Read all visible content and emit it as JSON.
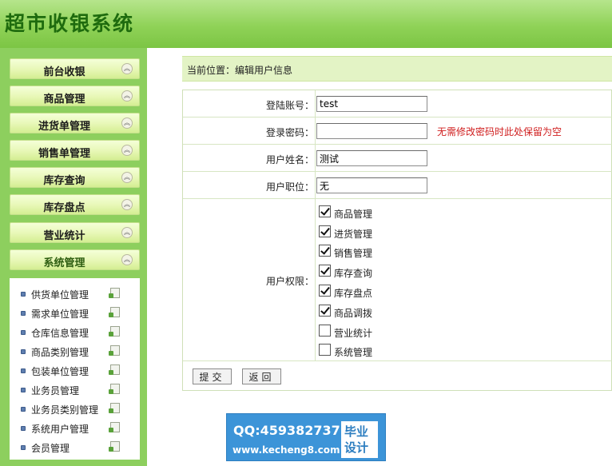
{
  "app": {
    "title": "超市收银系统"
  },
  "sidebar": {
    "nav": [
      {
        "label": "前台收银"
      },
      {
        "label": "商品管理"
      },
      {
        "label": "进货单管理"
      },
      {
        "label": "销售单管理"
      },
      {
        "label": "库存查询"
      },
      {
        "label": "库存盘点"
      },
      {
        "label": "营业统计"
      },
      {
        "label": "系统管理"
      }
    ],
    "chevron_glyph": "︽",
    "submenu": [
      {
        "label": "供货单位管理"
      },
      {
        "label": "需求单位管理"
      },
      {
        "label": "仓库信息管理"
      },
      {
        "label": "商品类别管理"
      },
      {
        "label": "包装单位管理"
      },
      {
        "label": "业务员管理"
      },
      {
        "label": "业务员类别管理"
      },
      {
        "label": "系统用户管理"
      },
      {
        "label": "会员管理"
      }
    ]
  },
  "breadcrumb": "当前位置：编辑用户信息",
  "form": {
    "account": {
      "label": "登陆账号：",
      "value": "test"
    },
    "password": {
      "label": "登录密码：",
      "value": "",
      "hint": "无需修改密码时此处保留为空"
    },
    "name": {
      "label": "用户姓名：",
      "value": "测试"
    },
    "position": {
      "label": "用户职位：",
      "value": "无"
    },
    "permissions": {
      "label": "用户权限：",
      "items": [
        {
          "label": "商品管理",
          "checked": true
        },
        {
          "label": "进货管理",
          "checked": true
        },
        {
          "label": "销售管理",
          "checked": true
        },
        {
          "label": "库存查询",
          "checked": true
        },
        {
          "label": "库存盘点",
          "checked": true
        },
        {
          "label": "商品调拨",
          "checked": true
        },
        {
          "label": "营业统计",
          "checked": false
        },
        {
          "label": "系统管理",
          "checked": false
        }
      ]
    },
    "submit_label": "提交",
    "back_label": "返回"
  },
  "promo": {
    "qq": "QQ:459382737",
    "site": "www.kecheng8.com",
    "badge_line1": "毕业",
    "badge_line2": "设计"
  },
  "colors": {
    "header_green": "#8fd257",
    "title_green": "#1e6b0e",
    "sidebar_green": "#8dcf5e",
    "hint_red": "#d02020",
    "promo_blue": "#3c94d8"
  }
}
